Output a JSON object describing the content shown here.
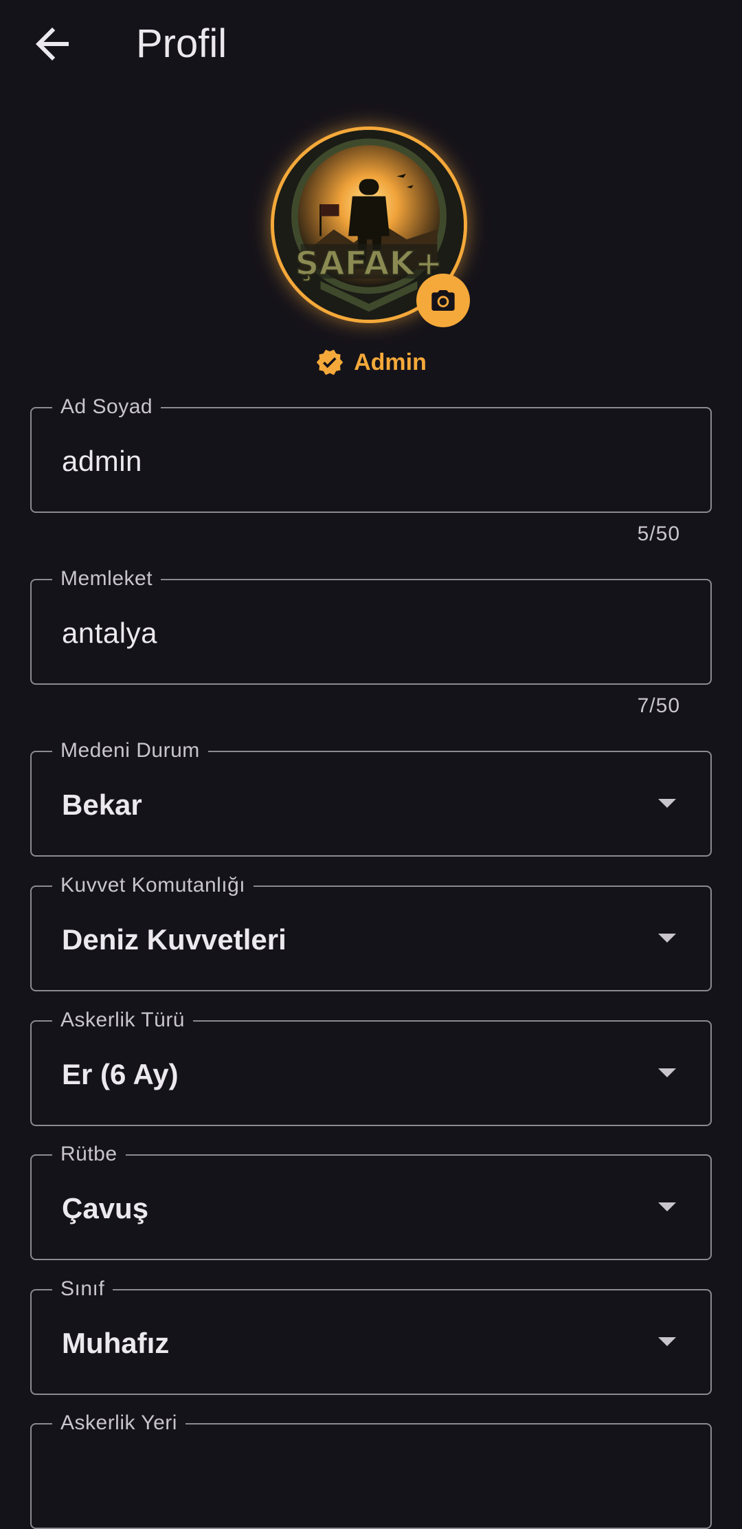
{
  "appbar": {
    "title": "Profil",
    "back_icon": "arrow-left-icon"
  },
  "profile": {
    "avatar_text": "ŞAFAK+",
    "camera_icon": "camera-icon",
    "role_icon": "verified-badge-icon",
    "role": "Admin"
  },
  "fields": {
    "name": {
      "label": "Ad Soyad",
      "value": "admin",
      "counter": "5/50"
    },
    "hometown": {
      "label": "Memleket",
      "value": "antalya",
      "counter": "7/50"
    },
    "marital": {
      "label": "Medeni Durum",
      "value": "Bekar"
    },
    "force": {
      "label": "Kuvvet Komutanlığı",
      "value": "Deniz Kuvvetleri"
    },
    "service_type": {
      "label": "Askerlik Türü",
      "value": "Er (6 Ay)"
    },
    "rank": {
      "label": "Rütbe",
      "value": "Çavuş"
    },
    "class": {
      "label": "Sınıf",
      "value": "Muhafız"
    },
    "location": {
      "label": "Askerlik Yeri"
    }
  },
  "colors": {
    "accent": "#f5a93a",
    "background": "#15131a",
    "outline": "#8d8a92"
  }
}
